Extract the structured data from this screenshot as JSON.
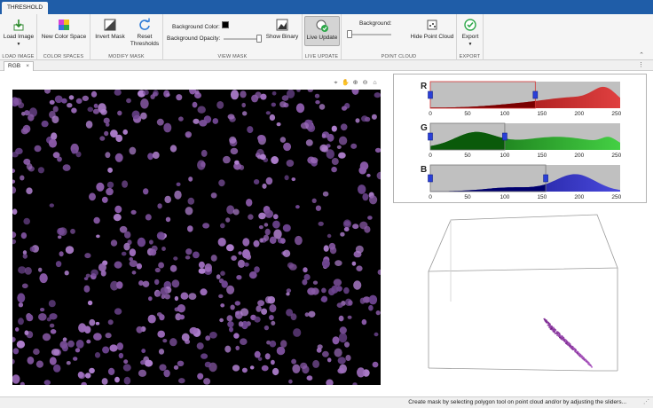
{
  "app": {
    "tab_title": "THRESHOLD"
  },
  "ribbon": {
    "load_image": {
      "button": "Load Image",
      "section": "LOAD IMAGE"
    },
    "color_spaces": {
      "button": "New Color Space",
      "section": "COLOR SPACES"
    },
    "modify_mask": {
      "invert": "Invert Mask",
      "reset_line1": "Reset",
      "reset_line2": "Thresholds",
      "section": "MODIFY MASK"
    },
    "view_mask": {
      "bg_color_label": "Background Color:",
      "bg_opacity_label": "Background Opacity:",
      "show_binary": "Show Binary",
      "section": "VIEW MASK",
      "bg_color_value": "#000000"
    },
    "live_update": {
      "button": "Live Update",
      "section": "LIVE UPDATE"
    },
    "point_cloud": {
      "background_label": "Background:",
      "hide_button": "Hide Point Cloud",
      "section": "POINT CLOUD"
    },
    "export": {
      "button": "Export",
      "section": "EXPORT"
    }
  },
  "document": {
    "tab_label": "RGB"
  },
  "histograms": {
    "axis_ticks": [
      "0",
      "50",
      "100",
      "150",
      "200",
      "250"
    ],
    "channels": [
      {
        "name": "R",
        "color": "#e04040",
        "dark": "#7a0000",
        "low": 0,
        "high": 141
      },
      {
        "name": "G",
        "color": "#44d044",
        "dark": "#0a5a0a",
        "low": 0,
        "high": 100
      },
      {
        "name": "B",
        "color": "#4a4adc",
        "dark": "#00006e",
        "low": 0,
        "high": 155
      }
    ]
  },
  "status": {
    "text": "Create mask by selecting polygon tool on point cloud and/or by adjusting the sliders..."
  }
}
